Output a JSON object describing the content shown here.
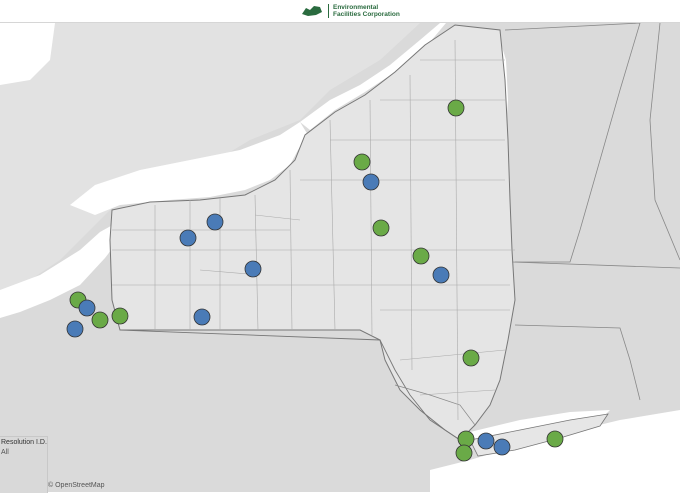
{
  "header": {
    "logo_line1": "Environmental",
    "logo_line2": "Facilities Corporation",
    "logo_mark_text": "NEW YORK STATE"
  },
  "filter": {
    "label": "Resolution I.D.",
    "value": "All"
  },
  "attribution": "© OpenStreetMap",
  "colors": {
    "green": "#6aaa47",
    "blue": "#4a7bb7",
    "land": "#d9d9d9",
    "water": "#ffffff",
    "state_border": "#777777",
    "county_border": "#a9a9a9"
  },
  "markers": [
    {
      "color": "green"
    },
    {
      "color": "green"
    },
    {
      "color": "blue"
    },
    {
      "color": "blue"
    },
    {
      "color": "blue"
    },
    {
      "color": "green"
    },
    {
      "color": "green"
    },
    {
      "color": "blue"
    },
    {
      "color": "blue"
    },
    {
      "color": "blue"
    },
    {
      "color": "green"
    },
    {
      "color": "green"
    },
    {
      "color": "green"
    },
    {
      "color": "green"
    },
    {
      "color": "blue"
    },
    {
      "color": "green"
    },
    {
      "color": "green"
    },
    {
      "color": "blue"
    },
    {
      "color": "blue"
    },
    {
      "color": "blue"
    },
    {
      "color": "green"
    }
  ]
}
